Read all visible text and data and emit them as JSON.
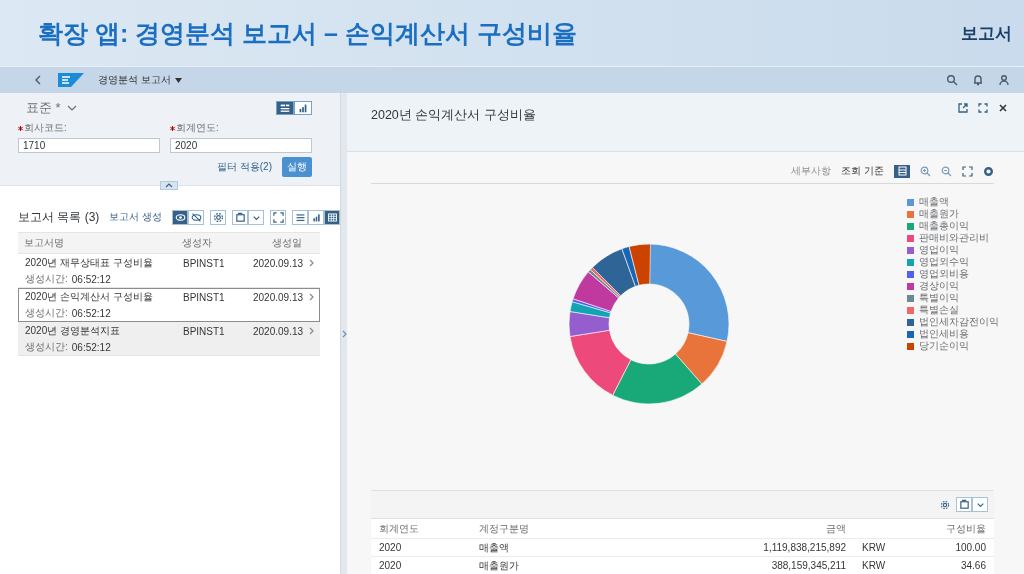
{
  "banner": {
    "title": "확장 앱: 경영분석 보고서 – 손익계산서 구성비율",
    "tag": "보고서"
  },
  "shell": {
    "app_title": "경영분석 보고서"
  },
  "filter_bar": {
    "variant": "표준 *",
    "view_toggle": [
      {
        "kind": "filter",
        "selected": true
      },
      {
        "kind": "chart",
        "selected": false
      }
    ],
    "fields": [
      {
        "label": "회사코드:",
        "required": true,
        "value": "1710"
      },
      {
        "label": "회계연도:",
        "required": true,
        "value": "2020"
      }
    ],
    "filter_button": "필터 적용(2)",
    "go_button": "실행"
  },
  "report_list": {
    "title": "보고서 목록 (3)",
    "create_link": "보고서 생성",
    "visibility_toggle": [
      {
        "kind": "show",
        "selected": true
      },
      {
        "kind": "hide",
        "selected": false
      }
    ],
    "view_toggle": [
      {
        "kind": "list",
        "selected": false
      },
      {
        "kind": "chart",
        "selected": false
      },
      {
        "kind": "table",
        "selected": true
      }
    ],
    "columns": [
      "보고서명",
      "생성자",
      "생성일"
    ],
    "rows": [
      {
        "name": "2020년 재무상태표 구성비율",
        "creator": "BPINST1",
        "date": "2020.09.13",
        "time_label": "생성시간:",
        "time": "06:52:12",
        "focused": false,
        "hovered": false
      },
      {
        "name": "2020년 손익계산서 구성비율",
        "creator": "BPINST1",
        "date": "2020.09.13",
        "time_label": "생성시간:",
        "time": "06:52:12",
        "focused": true,
        "hovered": false
      },
      {
        "name": "2020년 경영분석지표",
        "creator": "BPINST1",
        "date": "2020.09.13",
        "time_label": "생성시간:",
        "time": "06:52:12",
        "focused": false,
        "hovered": true
      }
    ]
  },
  "detail": {
    "title": "2020년 손익계산서 구성비율",
    "details_link": "세부사항",
    "view_by": "조회 기준",
    "legend": [
      {
        "label": "매출액",
        "color": "#5899da"
      },
      {
        "label": "매출원가",
        "color": "#e8743b"
      },
      {
        "label": "매출총이익",
        "color": "#19a979"
      },
      {
        "label": "판매비와관리비",
        "color": "#ed4a7b"
      },
      {
        "label": "영업이익",
        "color": "#945ecf"
      },
      {
        "label": "영업외수익",
        "color": "#13a4b4"
      },
      {
        "label": "영업외비용",
        "color": "#525df4"
      },
      {
        "label": "경상이익",
        "color": "#bf399e"
      },
      {
        "label": "특별이익",
        "color": "#6c8893"
      },
      {
        "label": "특별손실",
        "color": "#ee6868"
      },
      {
        "label": "법인세차감전이익",
        "color": "#2f6497"
      },
      {
        "label": "법인세비용",
        "color": "#1866b4"
      },
      {
        "label": "당기순이익",
        "color": "#cc4300"
      }
    ],
    "table": {
      "columns": [
        "회계연도",
        "계정구분명",
        "금액",
        "",
        "구성비율"
      ],
      "rows": [
        [
          "2020",
          "매출액",
          "1,119,838,215,892",
          "KRW",
          "100.00"
        ],
        [
          "2020",
          "매출원가",
          "388,159,345,211",
          "KRW",
          "34.66"
        ]
      ]
    }
  }
}
